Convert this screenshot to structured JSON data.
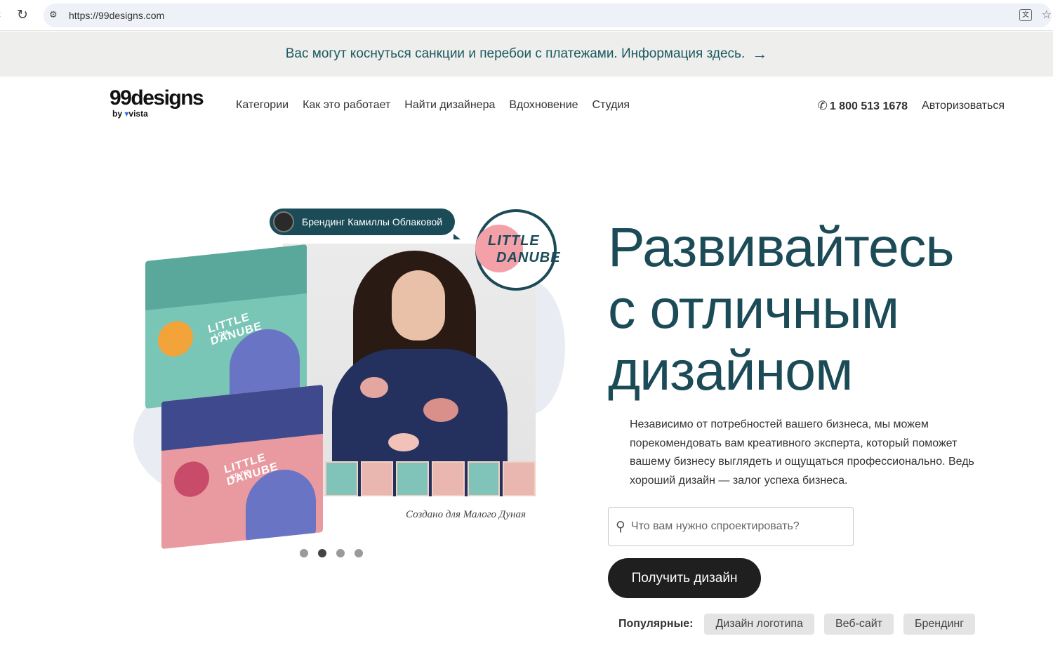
{
  "browser": {
    "url": "https://99designs.com",
    "reload_icon": "reload-icon",
    "translate_icon": "translate-icon",
    "bookmark_icon": "star-icon"
  },
  "banner": {
    "text": "Вас могут коснуться санкции и перебои с платежами. Информация здесь.",
    "arrow": "→"
  },
  "header": {
    "logo_word": "99designs",
    "logo_by": "by",
    "logo_vista": "vista",
    "nav": [
      "Категории",
      "Как это работает",
      "Найти дизайнера",
      "Вдохновение",
      "Студия"
    ],
    "phone": "1 800 513 1678",
    "login": "Авторизоваться"
  },
  "hero": {
    "designer_badge": "Брендинг Камиллы Облаковой",
    "client_logo_line1": "LITTLE",
    "client_logo_line2": "DANUBE",
    "box_label": "LITTLE DANUBE",
    "box1_sub": "LOM",
    "box2_sub": "KILIYA",
    "caption": "Создано для Малого Дуная",
    "carousel_count": 4,
    "carousel_active": 2,
    "headline_lines": [
      "Развивайтесь",
      "с отличным",
      "дизайном"
    ],
    "description": "Независимо от потребностей вашего бизнеса, мы можем порекомендовать вам креативного эксперта, который поможет вашему бизнесу выглядеть и ощущаться профессионально. Ведь хороший дизайн — залог успеха бизнеса.",
    "search_placeholder": "Что вам нужно спроектировать?",
    "cta": "Получить дизайн",
    "popular_label": "Популярные:",
    "popular_chips": [
      "Дизайн логотипа",
      "Веб-сайт",
      "Брендинг"
    ]
  },
  "colors": {
    "brand_teal": "#1c4b58",
    "banner_bg": "#eeeeec",
    "cta_bg": "#1f1f1f"
  }
}
